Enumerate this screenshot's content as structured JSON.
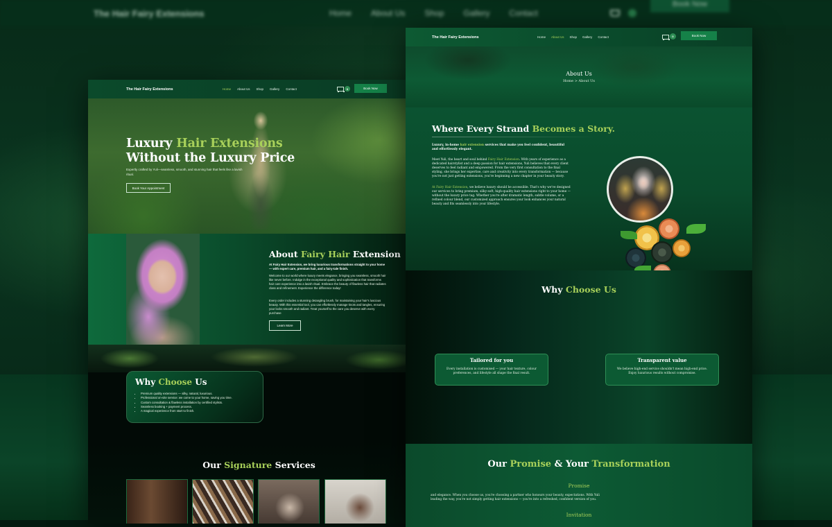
{
  "background": {
    "brand": "The Hair Fairy Extensions",
    "links": [
      "Home",
      "About Us",
      "Shop",
      "Gallery",
      "Contact"
    ],
    "book_label": "Book Now"
  },
  "home_page": {
    "nav": {
      "logo": "The Hair Fairy Extensions",
      "links": [
        "Home",
        "About Us",
        "Shop",
        "Gallery",
        "Contact"
      ],
      "active": "Home",
      "cart_count": "0",
      "book_label": "Book Now"
    },
    "hero": {
      "title_1": "Luxury ",
      "title_accent": "Hair Extensions",
      "title_2": "Without the Luxury Price",
      "subtitle": "Expertly crafted by Yuli—seamless, smooth, and stunning hair that feels like a lavish ritual.",
      "cta": "Book Your Appointment"
    },
    "about": {
      "title_1": "About ",
      "title_accent": "Fairy Hair",
      "title_2": " Extension",
      "lead": "At Fairy Hair Extension, we bring luxurious transformations straight to your home — with expert care, premium hair, and a fairy-tale finish.",
      "p1": "Welcome to our world where luxury meets elegance, bringing you seamless, smooth hair like never before. Indulge in the exceptional quality and sophistication that transforms hair care experience into a lavish ritual. Embrace the beauty of flawless hair that radiates class and refinement. Experience the difference today!",
      "p2": "Every order includes a stunning detangling brush, for maintaining your hair's luscious beauty. With this essential tool, you can effortlessly manage knots and tangles, ensuring your locks smooth and radiant. Treat yourself to the care you deserve with every purchase",
      "cta": "Learn More"
    },
    "why": {
      "title_1": "Why ",
      "title_accent": "Choose",
      "title_2": " Us",
      "items": [
        "Premium quality extensions — silky, natural, luxurious.",
        "Professional on-site service: we come to your home, saving you time.",
        "Custom consultation & flawless installation by certified stylists.",
        "Seamless booking + payment process.",
        "A magical experience from start to finish."
      ]
    },
    "services": {
      "title_1": "Our ",
      "title_accent": "Signature",
      "title_2": " Services"
    }
  },
  "about_page": {
    "nav": {
      "logo": "The Hair Fairy Extensions",
      "links": [
        "Home",
        "About Us",
        "Shop",
        "Gallery",
        "Contact"
      ],
      "active": "About Us",
      "cart_count": "0",
      "book_label": "Book Now"
    },
    "banner": {
      "title": "About Us",
      "crumb": "Home > About Us"
    },
    "story": {
      "title_1": "Where Every Strand ",
      "title_accent": "Becomes a Story.",
      "lead_1": "Luxury, in-home ",
      "lead_accent": "hair extension",
      "lead_2": " services that make you feel confident, beautiful and effortlessly elegant.",
      "p1_1": "Meet Yuli, the heart and soul behind ",
      "p1_accent": "Fairy Hair Extension",
      "p1_2": ". With years of experience as a dedicated hairstylist and a deep passion for hair extensions, Yuli believes that every client deserves to feel radiant and empowered. From the very first consultation to the final styling, she brings her expertise, care and creativity into every transformation — because you're not just getting extensions, you're beginning a new chapter in your beauty story.",
      "p2_accent": "At Fairy Hair Extension",
      "p2_2": ", we believe luxury should be accessible. That's why we've designed our services to bring premium, silky-soft, high-quality hair extensions right to your home — without the luxury price tag. Whether you're after dramatic length, subtle volume, or a refined colour blend, our customized approach ensures your look enhances your natural beauty and fits seamlessly into your lifestyle."
    },
    "why": {
      "title_1": "Why ",
      "title_accent": "Choose Us",
      "cards": [
        {
          "title": "Tailored for you",
          "text": "Every installation is customised — your hair texture, colour preferences, and lifestyle all shape the final result."
        },
        {
          "title": "Transparent value",
          "text": "We believe high-end service shouldn't mean high-end price. Enjoy luxurious results without compromise."
        }
      ]
    },
    "promise": {
      "title_1": "Our ",
      "title_accent_1": "Promise",
      "title_amp": " & Your ",
      "title_accent_2": "Transformation",
      "promise_label": "Promise",
      "promise_text": "and elegance. When you choose us, you're choosing a partner who honours your beauty, expectations. With Yuli leading the way, you're not simply getting hair extensions — you're into a refreshed, confident version of you.",
      "invitation_label": "Invitation"
    }
  },
  "colors": {
    "accent": "#a8d05a",
    "brand_green": "#0c4a2b",
    "button_green": "#158148"
  }
}
